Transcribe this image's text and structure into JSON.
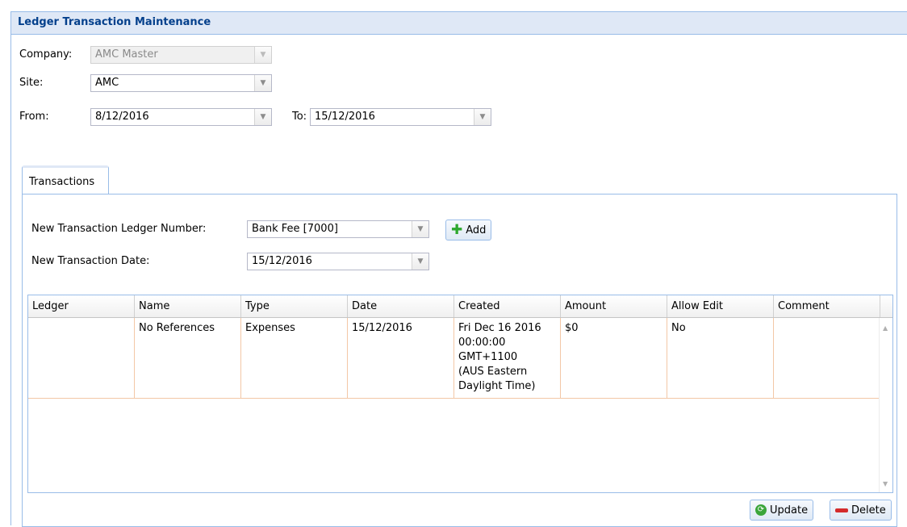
{
  "window": {
    "title": "Ledger Transaction Maintenance"
  },
  "filters": {
    "company_label": "Company:",
    "company_value": "AMC Master",
    "site_label": "Site:",
    "site_value": "AMC",
    "from_label": "From:",
    "from_value": "8/12/2016",
    "to_label": "To:",
    "to_value": "15/12/2016"
  },
  "tabs": [
    {
      "label": "Transactions"
    }
  ],
  "new_transaction": {
    "ledger_label": "New Transaction Ledger Number:",
    "ledger_value": "Bank Fee [7000]",
    "date_label": "New Transaction Date:",
    "date_value": "15/12/2016",
    "add_label": "Add"
  },
  "grid": {
    "columns": [
      "Ledger",
      "Name",
      "Type",
      "Date",
      "Created",
      "Amount",
      "Allow Edit",
      "Comment"
    ],
    "rows": [
      {
        "ledger": "",
        "name": "No References",
        "type": "Expenses",
        "date": "15/12/2016",
        "created_lines": [
          "Fri Dec 16 2016",
          "00:00:00",
          "GMT+1100",
          "(AUS Eastern",
          "Daylight Time)"
        ],
        "amount": "$0",
        "allow_edit": "No",
        "comment": ""
      }
    ]
  },
  "actions": {
    "update_label": "Update",
    "delete_label": "Delete"
  },
  "colors": {
    "header_bg": "#dfe8f6",
    "border": "#99bce8",
    "title_text": "#04408c",
    "row_border": "#f3c7a6"
  }
}
